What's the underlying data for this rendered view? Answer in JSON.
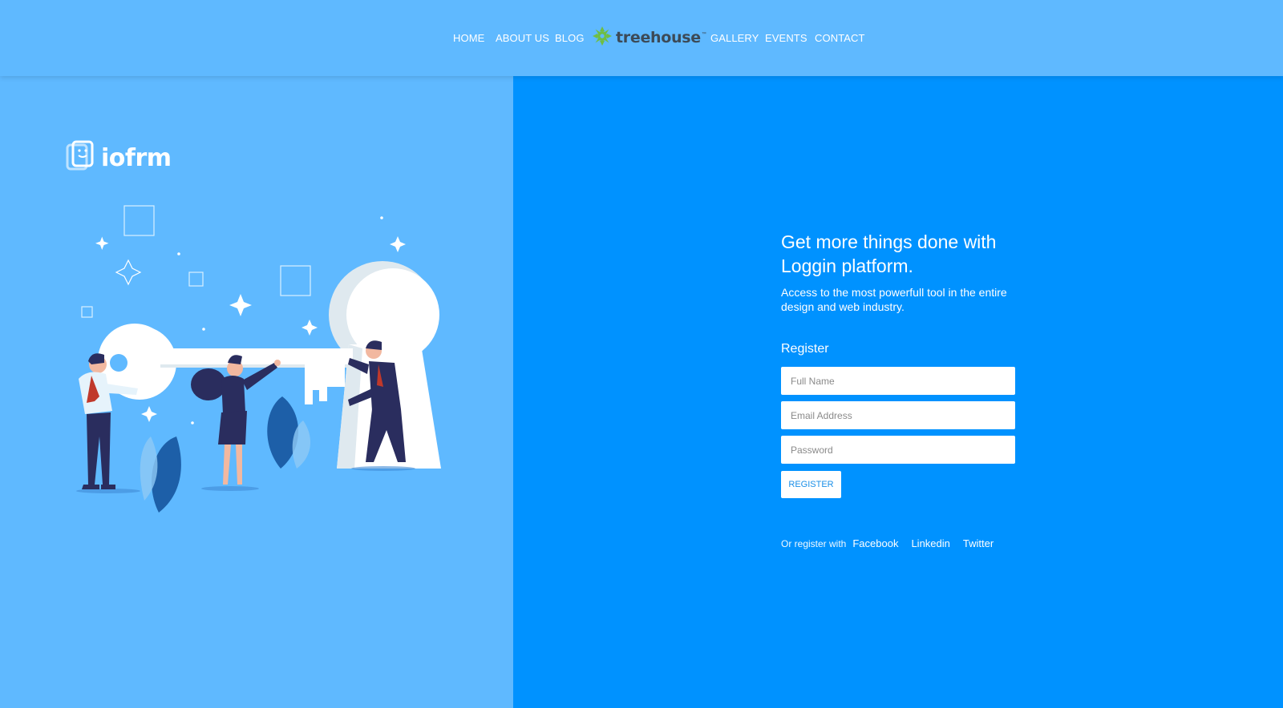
{
  "nav": {
    "left_items": [
      "HOME",
      "ABOUT US",
      "BLOG"
    ],
    "brand": "treehouse",
    "brand_tm": "™",
    "right_items": [
      "GALLERY",
      "EVENTS",
      "CONTACT"
    ]
  },
  "left": {
    "logo_text": "iofrm"
  },
  "form": {
    "headline": "Get more things done with Loggin platform.",
    "subline": "Access to the most powerfull tool in the entire design and web industry.",
    "title": "Register",
    "full_name_placeholder": "Full Name",
    "email_placeholder": "Email Address",
    "password_placeholder": "Password",
    "submit_label": "REGISTER",
    "social_prefix": "Or register with",
    "social_links": [
      "Facebook",
      "Linkedin",
      "Twitter"
    ]
  },
  "colors": {
    "nav_bg": "#5fb9ff",
    "left_bg": "#5fb9ff",
    "right_bg": "#0092ff",
    "brand_green": "#6fbe44"
  }
}
